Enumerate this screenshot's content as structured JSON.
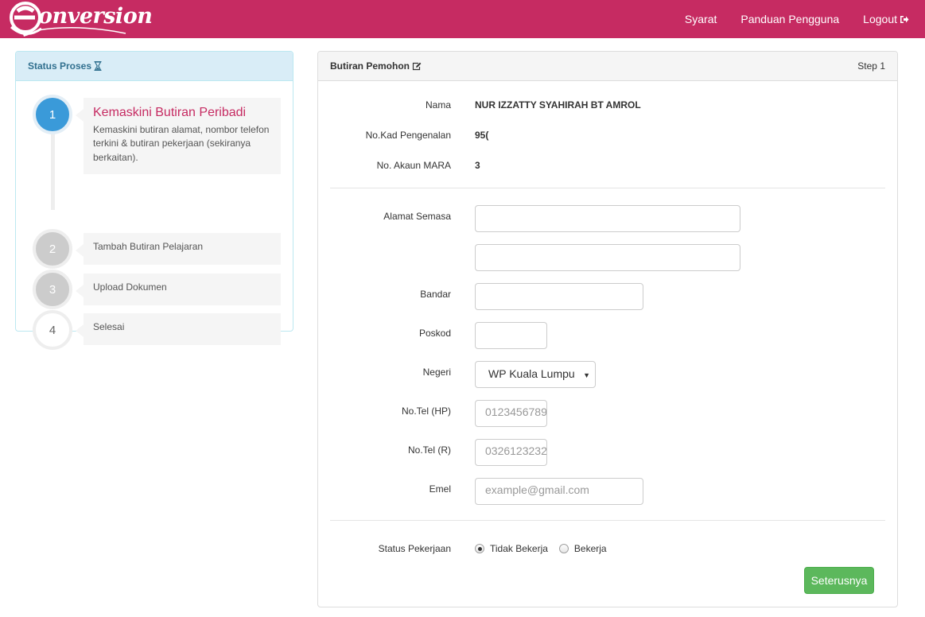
{
  "app": {
    "logo_text": "onversion",
    "brand_color": "#c62b62"
  },
  "nav": {
    "items": [
      {
        "label": "Syarat"
      },
      {
        "label": "Panduan Pengguna"
      },
      {
        "label": "Logout",
        "icon": "sign-out-icon"
      }
    ]
  },
  "status_panel": {
    "title": "Status Proses",
    "title_icon": "hourglass-icon",
    "steps": [
      {
        "number": "1",
        "title": "Kemaskini Butiran Peribadi",
        "description": "Kemaskini butiran alamat, nombor telefon terkini & butiran pekerjaan (sekiranya berkaitan).",
        "state": "active"
      },
      {
        "number": "2",
        "title": "Tambah Butiran Pelajaran",
        "state": "pending"
      },
      {
        "number": "3",
        "title": "Upload Dokumen",
        "state": "pending"
      },
      {
        "number": "4",
        "title": "Selesai",
        "state": "todo"
      }
    ]
  },
  "form_panel": {
    "title": "Butiran Pemohon",
    "title_icon": "edit-icon",
    "step_label": "Step 1",
    "info": {
      "nama_label": "Nama",
      "nama_value": "NUR IZZATTY SYAHIRAH BT AMROL",
      "ic_label": "No.Kad Pengenalan",
      "ic_value": "95(",
      "akaun_label": "No. Akaun MARA",
      "akaun_value": "3"
    },
    "fields": {
      "alamat_label": "Alamat Semasa",
      "alamat1_value": "",
      "alamat2_value": "",
      "bandar_label": "Bandar",
      "bandar_value": "",
      "poskod_label": "Poskod",
      "poskod_value": "",
      "negeri_label": "Negeri",
      "negeri_selected": "WP Kuala Lumpur",
      "tel_hp_label": "No.Tel (HP)",
      "tel_hp_placeholder": "0123456789",
      "tel_r_label": "No.Tel (R)",
      "tel_r_placeholder": "0326123232",
      "emel_label": "Emel",
      "emel_placeholder": "example@gmail.com"
    },
    "status_pekerjaan": {
      "label": "Status Pekerjaan",
      "options": [
        {
          "label": "Tidak Bekerja",
          "checked": true
        },
        {
          "label": "Bekerja",
          "checked": false
        }
      ]
    },
    "next_button": "Seterusnya",
    "accent_green": "#5cb85c"
  }
}
